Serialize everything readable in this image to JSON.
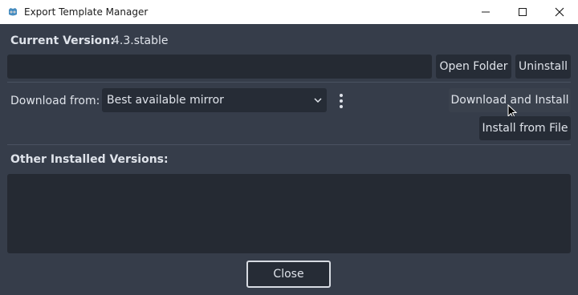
{
  "window": {
    "title": "Export Template Manager",
    "controls": {
      "minimize": "—",
      "maximize": "☐",
      "close": "✕"
    }
  },
  "current_version": {
    "label": "Current Version:",
    "value": "4.3.stable",
    "open_folder": "Open Folder",
    "uninstall": "Uninstall"
  },
  "download": {
    "label": "Download from:",
    "selected_mirror": "Best available mirror",
    "download_install": "Download and Install",
    "install_from_file": "Install from File"
  },
  "other_versions": {
    "label": "Other Installed Versions:"
  },
  "footer": {
    "close": "Close"
  }
}
